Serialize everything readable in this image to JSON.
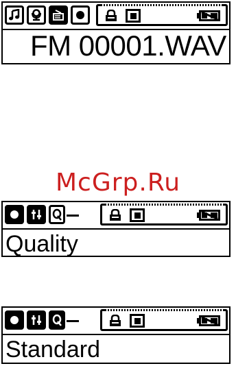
{
  "screens": [
    {
      "id": "recording-file",
      "main_text": "FM 00001.WAV",
      "icons": [
        "music-note-icon",
        "microphone-icon",
        "radio-icon",
        "record-icon"
      ],
      "selected_icon": "radio-icon"
    },
    {
      "id": "quality-menu",
      "main_text": "Quality",
      "icons": [
        "record-icon",
        "settings-icon",
        "quality-icon"
      ]
    },
    {
      "id": "standard-setting",
      "main_text": "Standard",
      "icons": [
        "record-icon",
        "settings-icon",
        "quality-icon"
      ]
    }
  ],
  "status_icons": [
    "lock-icon",
    "record-mode-icon",
    "battery-icon"
  ],
  "watermark": "McGrp.Ru",
  "colors": {
    "lcd_foreground": "#000000",
    "lcd_background": "#ffffff",
    "watermark": "#cc1f1f"
  }
}
